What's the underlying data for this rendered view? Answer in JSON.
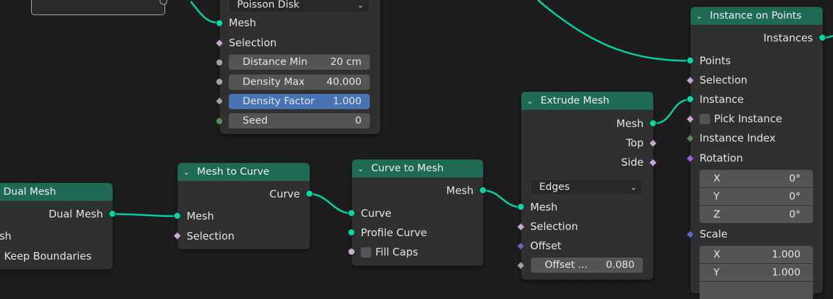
{
  "colors": {
    "geometry_socket": "#00d6a3",
    "float_socket": "#a1a1a1",
    "vector_socket": "#6363c7",
    "bool_socket": "#cca6d6",
    "int_socket": "#598c5c",
    "node_header": "#1e6a55",
    "active_field": "#4772b3",
    "link": "#00d6a3"
  },
  "distribute": {
    "mode": "Poisson Disk",
    "mesh": "Mesh",
    "selection": "Selection",
    "distance_min_label": "Distance Min",
    "distance_min_value": "20 cm",
    "density_max_label": "Density Max",
    "density_max_value": "40.000",
    "density_factor_label": "Density Factor",
    "density_factor_value": "1.000",
    "seed_label": "Seed",
    "seed_value": "0"
  },
  "instance_on_points": {
    "title": "Instance on Points",
    "instances": "Instances",
    "points": "Points",
    "selection": "Selection",
    "instance": "Instance",
    "pick_instance": "Pick Instance",
    "instance_index": "Instance Index",
    "rotation": "Rotation",
    "rot_x_label": "X",
    "rot_x_value": "0°",
    "rot_y_label": "Y",
    "rot_y_value": "0°",
    "rot_z_label": "Z",
    "rot_z_value": "0°",
    "scale": "Scale",
    "scale_x_label": "X",
    "scale_x_value": "1.000",
    "scale_y_label": "Y",
    "scale_y_value": "1.000"
  },
  "extrude_mesh": {
    "title": "Extrude Mesh",
    "mesh_out": "Mesh",
    "top": "Top",
    "side": "Side",
    "mode": "Edges",
    "mesh_in": "Mesh",
    "selection": "Selection",
    "offset": "Offset",
    "offset_scale_label": "Offset ...",
    "offset_scale_value": "0.080"
  },
  "curve_to_mesh": {
    "title": "Curve to Mesh",
    "mesh": "Mesh",
    "curve": "Curve",
    "profile_curve": "Profile Curve",
    "fill_caps": "Fill Caps"
  },
  "mesh_to_curve": {
    "title": "Mesh to Curve",
    "curve": "Curve",
    "mesh": "Mesh",
    "selection": "Selection"
  },
  "dual_mesh": {
    "title": "Dual Mesh",
    "dual_mesh": "Dual Mesh",
    "mesh": "esh",
    "keep_boundaries": "Keep Boundaries"
  }
}
